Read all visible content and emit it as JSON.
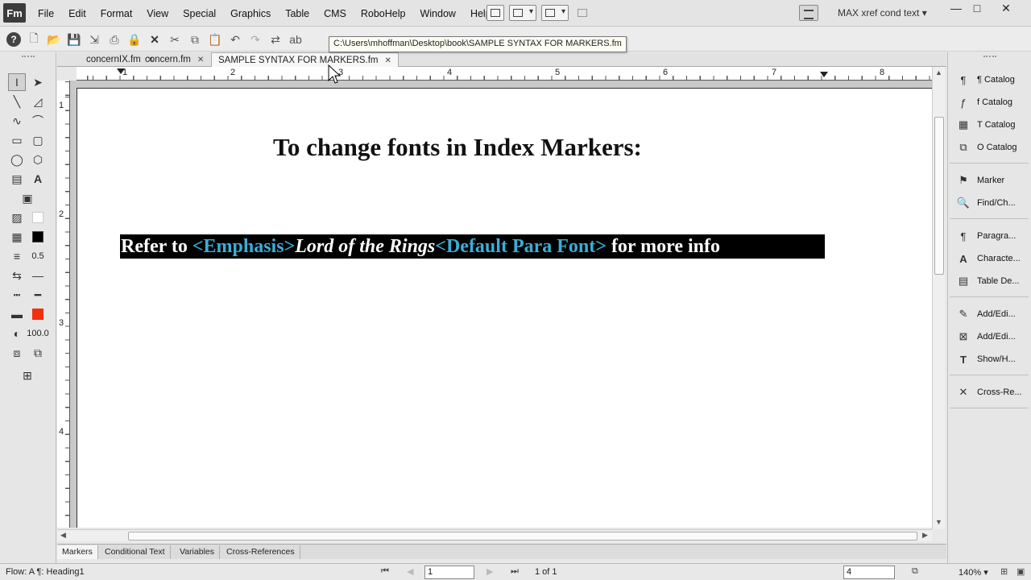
{
  "app": {
    "logo": "Fm"
  },
  "menubar": {
    "items": [
      "File",
      "Edit",
      "Format",
      "View",
      "Special",
      "Graphics",
      "Table",
      "CMS",
      "RoboHelp",
      "Window",
      "Help"
    ],
    "workspace": "MAX xref cond text",
    "window_controls": {
      "minimize": "—",
      "maximize": "□",
      "close": "✕"
    }
  },
  "toolbar": {
    "tooltip": "C:\\Users\\mhoffman\\Desktop\\book\\SAMPLE SYNTAX FOR MARKERS.fm"
  },
  "tabs": [
    {
      "label": "concernIX.fm",
      "active": false
    },
    {
      "label": "concern.fm",
      "active": false
    },
    {
      "label": "SAMPLE SYNTAX FOR MARKERS.fm",
      "active": true
    }
  ],
  "ruler": {
    "h_numbers": [
      "1",
      "2",
      "3",
      "4",
      "5",
      "6",
      "7",
      "8"
    ],
    "v_numbers": [
      "1",
      "2",
      "3",
      "4"
    ]
  },
  "tools": {
    "line_width": "0.5",
    "tint": "100.0"
  },
  "document": {
    "heading": "To change fonts in Index Markers:",
    "line": {
      "part1": "Refer to ",
      "tag1": "<Emphasis>",
      "italic": "Lord of the Rings",
      "tag2": "<Default Para Font>",
      "part2": " for more info"
    },
    "colors": {
      "tag": "#3aaed8",
      "highlight": "#000000",
      "fill_swatch": "#f03010"
    }
  },
  "bottom_tabs": [
    "Markers",
    "Conditional Text",
    "Variables",
    "Cross-References"
  ],
  "right_panel": [
    {
      "label": "¶ Catalog",
      "icon": "paragraph-catalog-icon"
    },
    {
      "label": "f Catalog",
      "icon": "character-catalog-icon"
    },
    {
      "label": "T Catalog",
      "icon": "table-catalog-icon"
    },
    {
      "label": "O Catalog",
      "icon": "object-catalog-icon"
    },
    {
      "label": "Marker",
      "icon": "marker-icon"
    },
    {
      "label": "Find/Ch...",
      "icon": "find-change-icon"
    },
    {
      "label": "Paragra...",
      "icon": "paragraph-designer-icon"
    },
    {
      "label": "Characte...",
      "icon": "character-designer-icon"
    },
    {
      "label": "Table De...",
      "icon": "table-designer-icon"
    },
    {
      "label": "Add/Edi...",
      "icon": "add-edit-icon"
    },
    {
      "label": "Add/Edi...",
      "icon": "add-edit-2-icon"
    },
    {
      "label": "Show/H...",
      "icon": "show-hide-icon"
    },
    {
      "label": "Cross-Re...",
      "icon": "cross-reference-icon"
    }
  ],
  "status": {
    "flow": "Flow: A  ¶: Heading1",
    "page_input": "1",
    "page_of": "1 of 1",
    "zoom_input": "4",
    "zoom": "140%"
  }
}
